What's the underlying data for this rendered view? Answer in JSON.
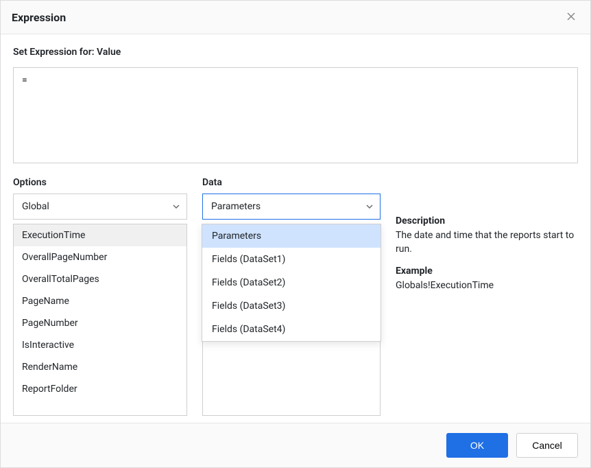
{
  "dialog": {
    "title": "Expression",
    "set_for_label": "Set Expression for: Value",
    "expression_value": "="
  },
  "options": {
    "label": "Options",
    "selected": "Global",
    "items": [
      "ExecutionTime",
      "OverallPageNumber",
      "OverallTotalPages",
      "PageName",
      "PageNumber",
      "IsInteractive",
      "RenderName",
      "ReportFolder"
    ],
    "selected_index": 0
  },
  "data": {
    "label": "Data",
    "selected": "Parameters",
    "dropdown_items": [
      "Parameters",
      "Fields (DataSet1)",
      "Fields (DataSet2)",
      "Fields (DataSet3)",
      "Fields (DataSet4)"
    ],
    "highlight_index": 0
  },
  "info": {
    "description_label": "Description",
    "description_text": "The date and time that the reports start to run.",
    "example_label": "Example",
    "example_text": "Globals!ExecutionTime"
  },
  "footer": {
    "ok": "OK",
    "cancel": "Cancel"
  }
}
